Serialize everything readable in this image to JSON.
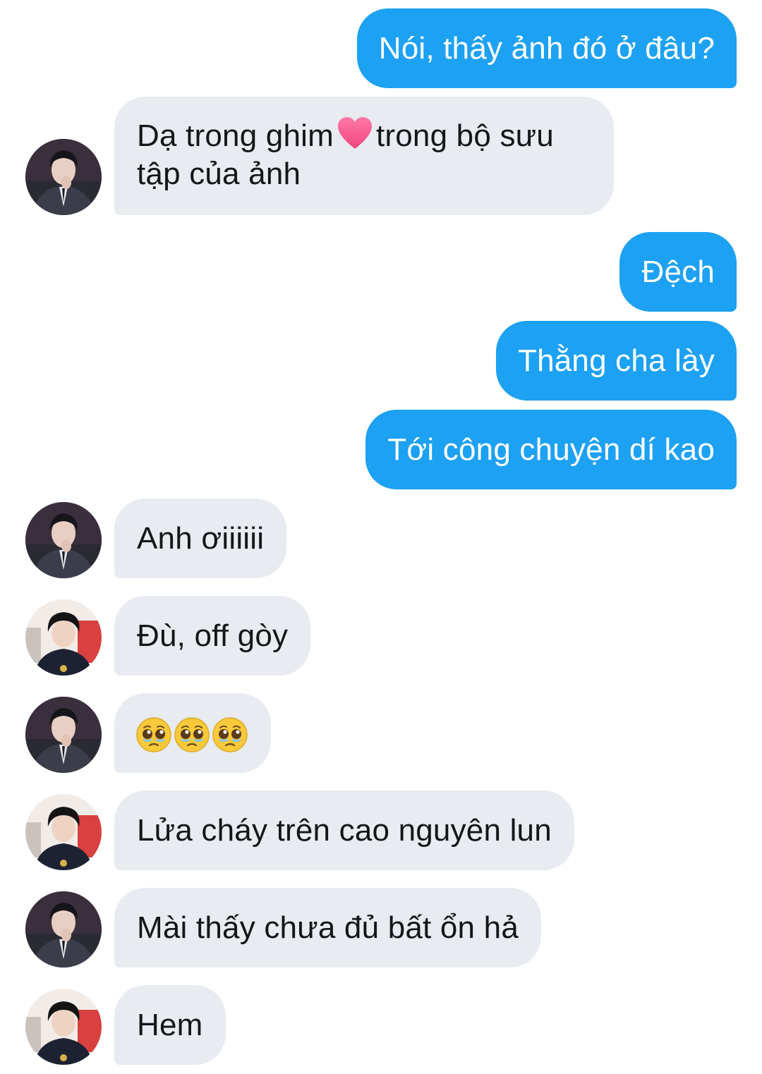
{
  "messages": [
    {
      "side": "out",
      "text": "Nói, thấy ảnh đó ở đâu?"
    },
    {
      "side": "in",
      "sender": "user-a",
      "text_before": "Dạ trong ghim",
      "emoji": "pink-heart-icon",
      "text_line1_after": "trong bộ sưu",
      "text_line2": "tập của ảnh"
    },
    {
      "side": "out",
      "text": "Đệch"
    },
    {
      "side": "out",
      "text": "Thằng cha lày"
    },
    {
      "side": "out",
      "text": "Tới công chuyện dí kao"
    },
    {
      "side": "in",
      "sender": "user-a",
      "text": "Anh ơiiiiii"
    },
    {
      "side": "in",
      "sender": "user-b",
      "text": "Đù, off gòy"
    },
    {
      "side": "in",
      "sender": "user-a",
      "emoji": [
        "pleading-face-icon",
        "pleading-face-icon",
        "pleading-face-icon"
      ]
    },
    {
      "side": "in",
      "sender": "user-b",
      "text": "Lửa cháy trên cao nguyên lun"
    },
    {
      "side": "in",
      "sender": "user-a",
      "text": "Mài thấy chưa đủ bất ổn hả"
    },
    {
      "side": "in",
      "sender": "user-b",
      "text": "Hem"
    }
  ],
  "colors": {
    "outgoing_bubble": "#1da1f2",
    "incoming_bubble": "#e8ebef",
    "incoming_text": "#14171a",
    "outgoing_text": "#ffffff"
  }
}
